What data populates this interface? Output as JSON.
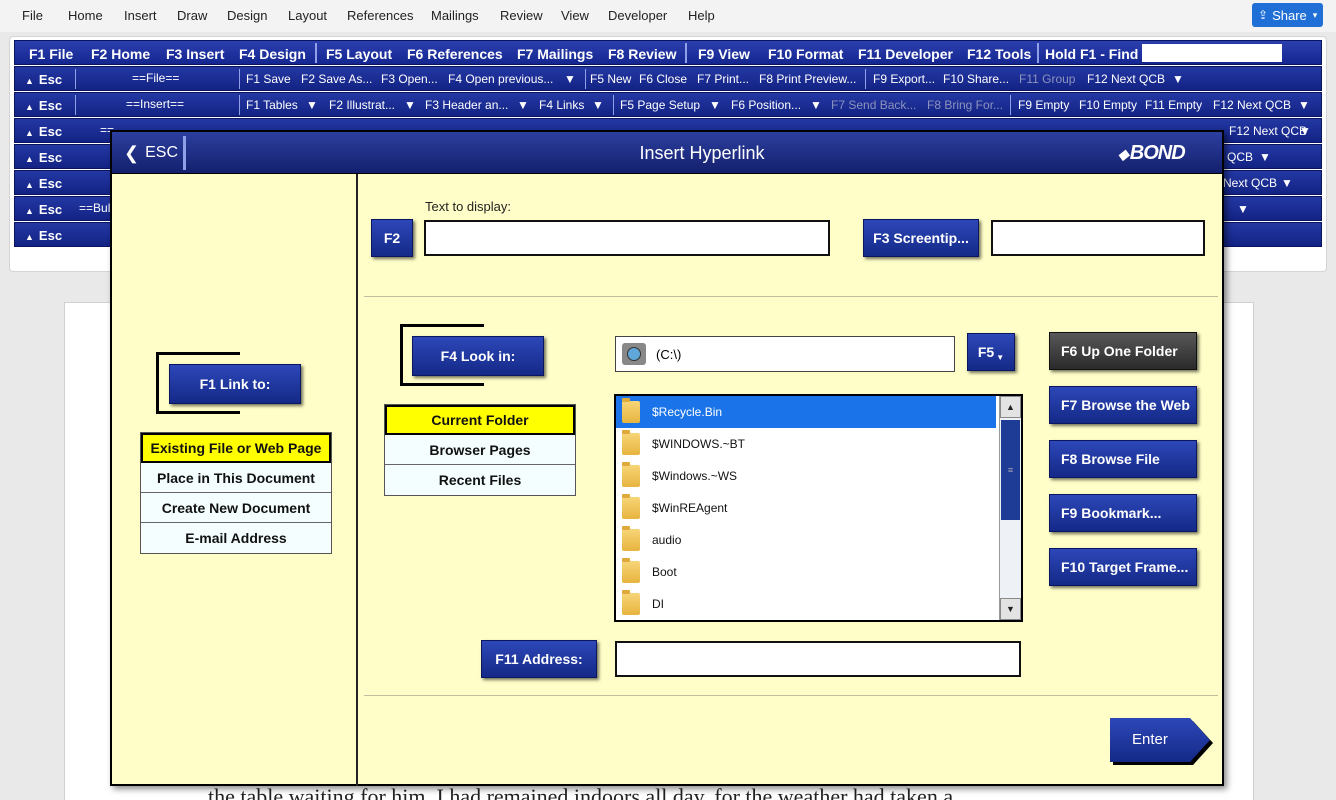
{
  "menubar": {
    "items": [
      "File",
      "Home",
      "Insert",
      "Draw",
      "Design",
      "Layout",
      "References",
      "Mailings",
      "Review",
      "View",
      "Developer",
      "Help"
    ],
    "share_label": "Share"
  },
  "fkeys": [
    "F1 File",
    "F2 Home",
    "F3 Insert",
    "F4 Design",
    "F5 Layout",
    "F6 References",
    "F7 Mailings",
    "F8 Review",
    "F9 View",
    "F10 Format",
    "F11 Developer",
    "F12 Tools",
    "Hold F1 - Find"
  ],
  "ribbon": {
    "esc_label": "Esc",
    "row1": {
      "group": "==File==",
      "items": [
        "F1 Save",
        "F2 Save As...",
        "F3 Open...",
        "F4 Open previous...",
        "F5 New",
        "F6 Close",
        "F7 Print...",
        "F8 Print Preview...",
        "F9 Export...",
        "F10 Share...",
        "F11 Group",
        "F12 Next QCB"
      ]
    },
    "row2": {
      "group": "==Insert==",
      "items": [
        "F1 Tables",
        "F2 Illustrat...",
        "F3 Header an...",
        "F4 Links",
        "F5 Page Setup",
        "F6 Position...",
        "F7 Send Back...",
        "F8 Bring For...",
        "F9 Empty",
        "F10 Empty",
        "F11 Empty",
        "F12 Next QCB"
      ]
    },
    "row3": {
      "group": "==",
      "right": "F12 Next QCB"
    },
    "row4": {
      "right": "QCB"
    },
    "row5": {
      "right": "Next QCB"
    },
    "row6": {
      "group": "==Bul"
    }
  },
  "dialog": {
    "esc_label": "ESC",
    "title": "Insert Hyperlink",
    "brand": "BOND",
    "f1_link_to": "F1 Link to:",
    "link_options": [
      "Existing File or Web Page",
      "Place in This Document",
      "Create New Document",
      "E-mail Address"
    ],
    "text_to_display_label": "Text to display:",
    "text_to_display_value": "",
    "f2_label": "F2",
    "f3_label": "F3 Screentip...",
    "screentip_value": "",
    "f4_look_in": "F4 Look in:",
    "look_in_value": "(C:\\)",
    "f5_label": "F5",
    "look_options": [
      "Current Folder",
      "Browser Pages",
      "Recent Files"
    ],
    "files": [
      "$Recycle.Bin",
      "$WINDOWS.~BT",
      "$Windows.~WS",
      "$WinREAgent",
      "audio",
      "Boot",
      "DI"
    ],
    "right_buttons": [
      "F6 Up One Folder",
      "F7 Browse the Web",
      "F8 Browse File",
      "F9 Bookmark...",
      "F10 Target Frame..."
    ],
    "f11_address": "F11 Address:",
    "address_value": "",
    "enter_label": "Enter"
  },
  "document": {
    "visible_text": "the table waiting for him. I had remained indoors all day, for the weather had taken a"
  }
}
